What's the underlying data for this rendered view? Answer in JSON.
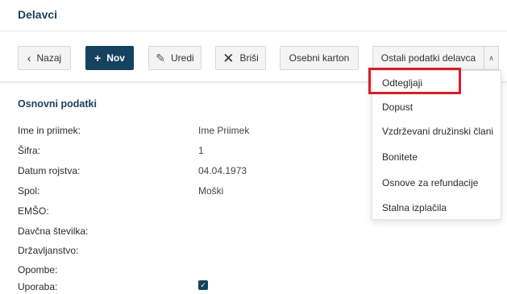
{
  "page": {
    "title": "Delavci"
  },
  "toolbar": {
    "back_label": "Nazaj",
    "new_label": "Nov",
    "edit_label": "Uredi",
    "delete_label": "Briši",
    "card_label": "Osebni karton",
    "other_label": "Ostali podatki delavca",
    "icons": {
      "back": "chevron-left-icon",
      "new": "plus-icon",
      "edit": "pencil-icon",
      "delete": "x-icon",
      "caret": "chevron-up-icon"
    }
  },
  "dropdown": {
    "items": [
      "Odtegljaji",
      "Dopust",
      "Vzdrževani družinski člani",
      "Bonitete",
      "Osnove za refundacije",
      "Stalna izplačila"
    ]
  },
  "section": {
    "title": "Osnovni podatki",
    "rows": [
      {
        "label": "Ime in priimek:",
        "value": "Ime Priimek"
      },
      {
        "label": "Šifra:",
        "value": "1"
      },
      {
        "label": "Datum rojstva:",
        "value": "04.04.1973"
      },
      {
        "label": "Spol:",
        "value": "Moški"
      },
      {
        "label": "EMŠO:",
        "value": ""
      },
      {
        "label": "Davčna številka:",
        "value": ""
      },
      {
        "label": "Državljanstvo:",
        "value": ""
      },
      {
        "label": "Opombe:",
        "value": ""
      },
      {
        "label": "Uporaba:",
        "value": ""
      }
    ],
    "usage_checked": true
  },
  "colors": {
    "primary": "#15435f",
    "title": "#1a3f5c",
    "highlight": "#d41f2a"
  }
}
